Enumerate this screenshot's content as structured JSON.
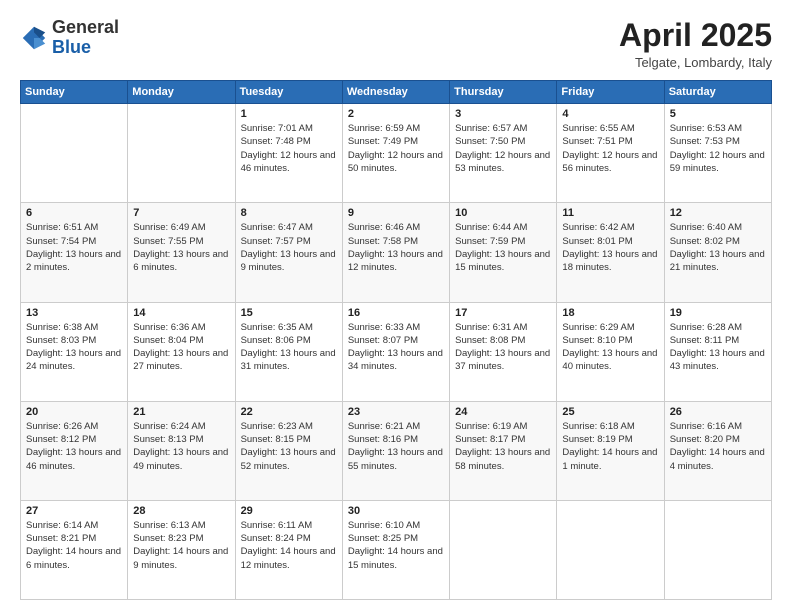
{
  "header": {
    "logo_general": "General",
    "logo_blue": "Blue",
    "month_title": "April 2025",
    "location": "Telgate, Lombardy, Italy"
  },
  "weekdays": [
    "Sunday",
    "Monday",
    "Tuesday",
    "Wednesday",
    "Thursday",
    "Friday",
    "Saturday"
  ],
  "weeks": [
    [
      {
        "day": "",
        "info": ""
      },
      {
        "day": "",
        "info": ""
      },
      {
        "day": "1",
        "info": "Sunrise: 7:01 AM\nSunset: 7:48 PM\nDaylight: 12 hours and 46 minutes."
      },
      {
        "day": "2",
        "info": "Sunrise: 6:59 AM\nSunset: 7:49 PM\nDaylight: 12 hours and 50 minutes."
      },
      {
        "day": "3",
        "info": "Sunrise: 6:57 AM\nSunset: 7:50 PM\nDaylight: 12 hours and 53 minutes."
      },
      {
        "day": "4",
        "info": "Sunrise: 6:55 AM\nSunset: 7:51 PM\nDaylight: 12 hours and 56 minutes."
      },
      {
        "day": "5",
        "info": "Sunrise: 6:53 AM\nSunset: 7:53 PM\nDaylight: 12 hours and 59 minutes."
      }
    ],
    [
      {
        "day": "6",
        "info": "Sunrise: 6:51 AM\nSunset: 7:54 PM\nDaylight: 13 hours and 2 minutes."
      },
      {
        "day": "7",
        "info": "Sunrise: 6:49 AM\nSunset: 7:55 PM\nDaylight: 13 hours and 6 minutes."
      },
      {
        "day": "8",
        "info": "Sunrise: 6:47 AM\nSunset: 7:57 PM\nDaylight: 13 hours and 9 minutes."
      },
      {
        "day": "9",
        "info": "Sunrise: 6:46 AM\nSunset: 7:58 PM\nDaylight: 13 hours and 12 minutes."
      },
      {
        "day": "10",
        "info": "Sunrise: 6:44 AM\nSunset: 7:59 PM\nDaylight: 13 hours and 15 minutes."
      },
      {
        "day": "11",
        "info": "Sunrise: 6:42 AM\nSunset: 8:01 PM\nDaylight: 13 hours and 18 minutes."
      },
      {
        "day": "12",
        "info": "Sunrise: 6:40 AM\nSunset: 8:02 PM\nDaylight: 13 hours and 21 minutes."
      }
    ],
    [
      {
        "day": "13",
        "info": "Sunrise: 6:38 AM\nSunset: 8:03 PM\nDaylight: 13 hours and 24 minutes."
      },
      {
        "day": "14",
        "info": "Sunrise: 6:36 AM\nSunset: 8:04 PM\nDaylight: 13 hours and 27 minutes."
      },
      {
        "day": "15",
        "info": "Sunrise: 6:35 AM\nSunset: 8:06 PM\nDaylight: 13 hours and 31 minutes."
      },
      {
        "day": "16",
        "info": "Sunrise: 6:33 AM\nSunset: 8:07 PM\nDaylight: 13 hours and 34 minutes."
      },
      {
        "day": "17",
        "info": "Sunrise: 6:31 AM\nSunset: 8:08 PM\nDaylight: 13 hours and 37 minutes."
      },
      {
        "day": "18",
        "info": "Sunrise: 6:29 AM\nSunset: 8:10 PM\nDaylight: 13 hours and 40 minutes."
      },
      {
        "day": "19",
        "info": "Sunrise: 6:28 AM\nSunset: 8:11 PM\nDaylight: 13 hours and 43 minutes."
      }
    ],
    [
      {
        "day": "20",
        "info": "Sunrise: 6:26 AM\nSunset: 8:12 PM\nDaylight: 13 hours and 46 minutes."
      },
      {
        "day": "21",
        "info": "Sunrise: 6:24 AM\nSunset: 8:13 PM\nDaylight: 13 hours and 49 minutes."
      },
      {
        "day": "22",
        "info": "Sunrise: 6:23 AM\nSunset: 8:15 PM\nDaylight: 13 hours and 52 minutes."
      },
      {
        "day": "23",
        "info": "Sunrise: 6:21 AM\nSunset: 8:16 PM\nDaylight: 13 hours and 55 minutes."
      },
      {
        "day": "24",
        "info": "Sunrise: 6:19 AM\nSunset: 8:17 PM\nDaylight: 13 hours and 58 minutes."
      },
      {
        "day": "25",
        "info": "Sunrise: 6:18 AM\nSunset: 8:19 PM\nDaylight: 14 hours and 1 minute."
      },
      {
        "day": "26",
        "info": "Sunrise: 6:16 AM\nSunset: 8:20 PM\nDaylight: 14 hours and 4 minutes."
      }
    ],
    [
      {
        "day": "27",
        "info": "Sunrise: 6:14 AM\nSunset: 8:21 PM\nDaylight: 14 hours and 6 minutes."
      },
      {
        "day": "28",
        "info": "Sunrise: 6:13 AM\nSunset: 8:23 PM\nDaylight: 14 hours and 9 minutes."
      },
      {
        "day": "29",
        "info": "Sunrise: 6:11 AM\nSunset: 8:24 PM\nDaylight: 14 hours and 12 minutes."
      },
      {
        "day": "30",
        "info": "Sunrise: 6:10 AM\nSunset: 8:25 PM\nDaylight: 14 hours and 15 minutes."
      },
      {
        "day": "",
        "info": ""
      },
      {
        "day": "",
        "info": ""
      },
      {
        "day": "",
        "info": ""
      }
    ]
  ]
}
